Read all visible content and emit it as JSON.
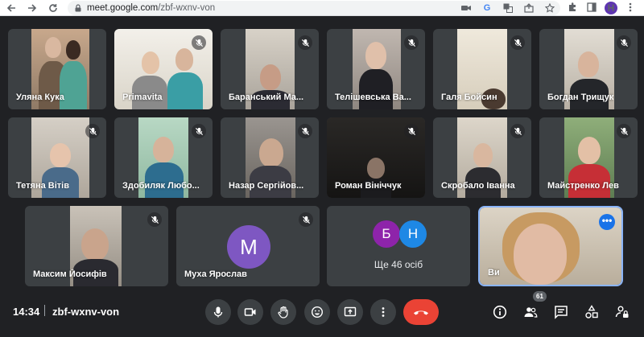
{
  "browser": {
    "url_host": "meet.google.com",
    "url_path": "/zbf-wxnv-von",
    "profile_initial": "H"
  },
  "participants": [
    {
      "name": "Уляна Кука",
      "muted": false
    },
    {
      "name": "Primavita",
      "muted": true
    },
    {
      "name": "Баранський Ма...",
      "muted": true
    },
    {
      "name": "Телішевська Ва...",
      "muted": true
    },
    {
      "name": "Галя Бойсин",
      "muted": true
    },
    {
      "name": "Богдан Трищук",
      "muted": true
    },
    {
      "name": "Тетяна Вітів",
      "muted": true
    },
    {
      "name": "Здобиляк Любо...",
      "muted": true
    },
    {
      "name": "Назар Сергійов...",
      "muted": true
    },
    {
      "name": "Роман Вініччук",
      "muted": true
    },
    {
      "name": "Скробало Іванна",
      "muted": true
    },
    {
      "name": "Майстренко Лев",
      "muted": true
    },
    {
      "name": "Максим Йосифів",
      "muted": true
    },
    {
      "name": "Муха Ярослав",
      "muted": true,
      "avatar_letter": "M",
      "avatar_color": "#7e57c2"
    }
  ],
  "others": {
    "label": "Ще 46 осіб",
    "avatars": [
      {
        "letter": "Б",
        "color": "#8e24aa"
      },
      {
        "letter": "Н",
        "color": "#1e88e5"
      }
    ]
  },
  "self_tile": {
    "name": "Ви"
  },
  "meeting": {
    "time": "14:34",
    "code": "zbf-wxnv-von",
    "participant_count": "61"
  },
  "colors": {
    "background": "#202124",
    "tile": "#3c4043",
    "hangup": "#ea4335",
    "accent": "#1a73e8"
  }
}
